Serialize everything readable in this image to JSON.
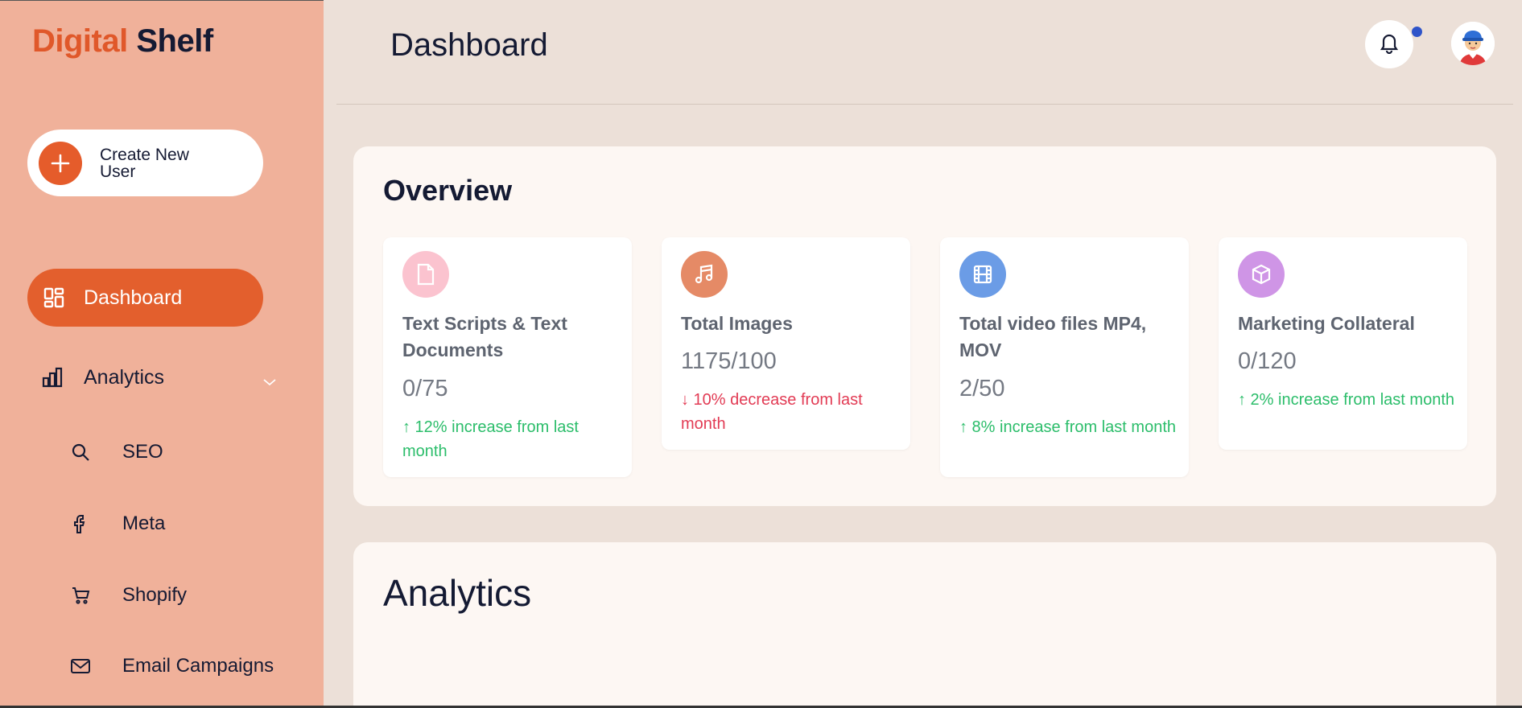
{
  "sidebar": {
    "logo_part1": "Digital",
    "logo_part2": "Shelf",
    "create_button_label": "Create New User",
    "nav": {
      "dashboard": "Dashboard",
      "analytics": "Analytics"
    },
    "sub_items": [
      {
        "label": "SEO",
        "icon": "search-icon"
      },
      {
        "label": "Meta",
        "icon": "facebook-icon"
      },
      {
        "label": "Shopify",
        "icon": "cart-icon"
      },
      {
        "label": "Email Campaigns",
        "icon": "mail-icon"
      }
    ]
  },
  "header": {
    "title": "Dashboard",
    "notification_dot_color": "#2f54c9"
  },
  "overview": {
    "title": "Overview",
    "cards": [
      {
        "title": "Text Scripts & Text Documents",
        "value": "0/75",
        "delta": "↑ 12% increase from last month",
        "trend": "up",
        "icon": "document-icon",
        "icon_color": "#fbc3cf"
      },
      {
        "title": "Total Images",
        "value": "1175/100",
        "delta": "↓ 10% decrease from last month",
        "trend": "down",
        "icon": "music-icon",
        "icon_color": "#e58a66"
      },
      {
        "title": "Total video files MP4, MOV",
        "value": "2/50",
        "delta": "↑ 8% increase from last month",
        "trend": "up",
        "icon": "film-icon",
        "icon_color": "#6b9ce6"
      },
      {
        "title": "Marketing Collateral",
        "value": "0/120",
        "delta": "↑ 2% increase from last month",
        "trend": "up",
        "icon": "box-icon",
        "icon_color": "#cf95e6"
      }
    ]
  },
  "analytics_section": {
    "title": "Analytics"
  },
  "colors": {
    "sidebar_bg": "#f0b19a",
    "accent": "#e35f2d",
    "page_bg": "#ece0d8",
    "up": "#2bbd6a",
    "down": "#e23b54"
  }
}
